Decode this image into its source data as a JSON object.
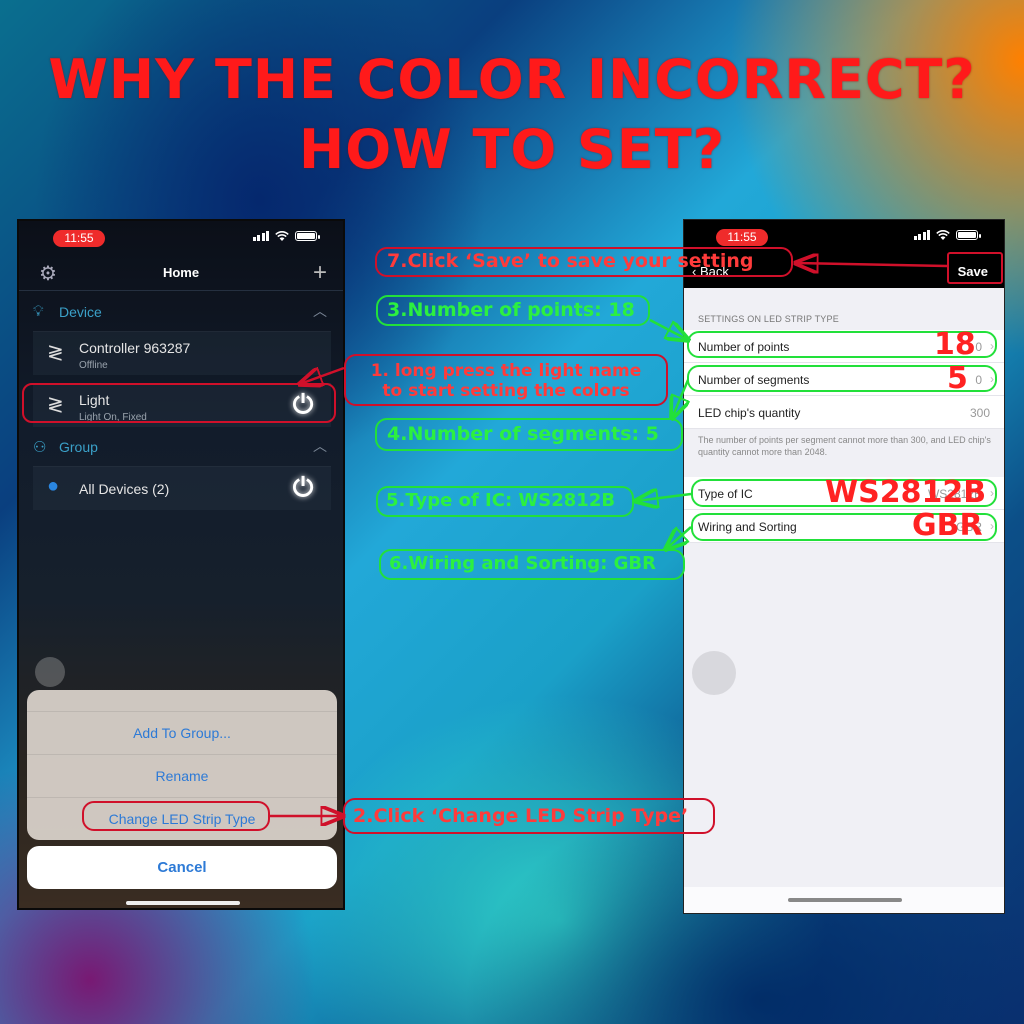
{
  "headline": {
    "line1": "WHY THE COLOR INCORRECT?",
    "line2": "HOW TO SET?"
  },
  "colors": {
    "annotation_red": "#d0102a",
    "annotation_green": "#22e03a",
    "ios_blue": "#2d7ad6",
    "section_blue": "#3aa0c8"
  },
  "left_phone": {
    "status": {
      "time": "11:55"
    },
    "nav": {
      "title": "Home",
      "left_icon": "gear-icon",
      "right_icon": "plus-icon"
    },
    "device_section": {
      "title": "Device",
      "items": [
        {
          "name": "Controller  963287",
          "status": "Offline",
          "icon": "led-strip-icon"
        },
        {
          "name": "Light",
          "status": "Light On, Fixed",
          "icon": "led-strip-icon",
          "power": true
        }
      ]
    },
    "group_section": {
      "title": "Group",
      "items": [
        {
          "name": "All Devices (2)",
          "icon": "bulb-icon",
          "power": true
        }
      ]
    },
    "action_sheet": {
      "items": [
        "Add To Group...",
        "Rename",
        "Change LED Strip Type"
      ],
      "cancel": "Cancel"
    }
  },
  "right_phone": {
    "status": {
      "time": "11:55"
    },
    "nav": {
      "back": "Back",
      "save": "Save"
    },
    "group_label": "SETTINGS ON LED STRIP TYPE",
    "rows": [
      {
        "label": "Number of points",
        "value": "0",
        "arrow": true
      },
      {
        "label": "Number of segments",
        "value": "0",
        "arrow": true
      },
      {
        "label": "LED chip's quantity",
        "value": "300",
        "arrow": false
      }
    ],
    "footnote": "The number of points per segment cannot more than 300, and LED chip's quantity cannot  more than 2048.",
    "rows2": [
      {
        "label": "Type of IC",
        "value": "WS2812B",
        "arrow": true
      },
      {
        "label": "Wiring and Sorting",
        "value": "GBR",
        "arrow": true
      }
    ]
  },
  "annotations": {
    "step1": {
      "line1": "1. long press the light name",
      "line2": "to start setting the colors"
    },
    "step2": "2.Click ‘Change LED Strip Type’",
    "step3": "3.Number of points: 18",
    "step4": "4.Number of segments: 5",
    "step5": "5.Type of IC: WS2812B",
    "step6": "6.Wiring and Sorting: GBR",
    "step7": "7.Click ‘Save’ to save your setting",
    "overlay_values": {
      "points": "18",
      "segments": "5",
      "ic_type": "WS2812B",
      "wiring": "GBR"
    }
  }
}
